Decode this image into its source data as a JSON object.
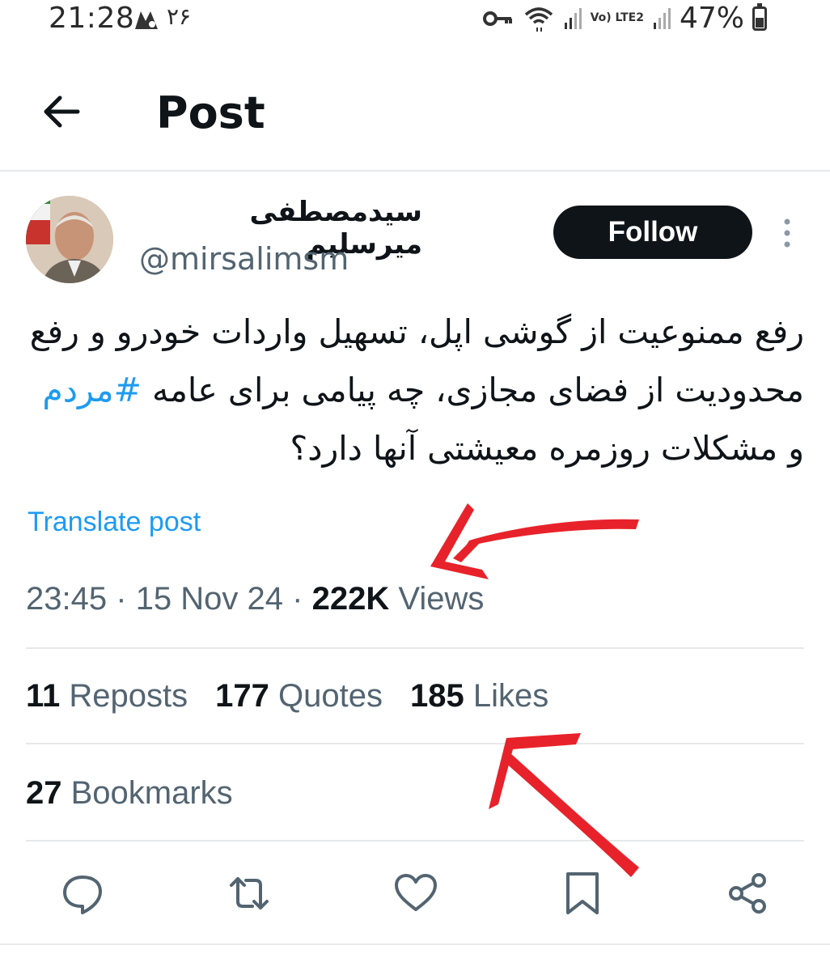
{
  "status_bar": {
    "time": "21:28",
    "notification_count": "۲۶",
    "lte_label": "Vo) LTE2",
    "battery_percent": "47%",
    "battery_level": 0.47,
    "icons": [
      "key-icon",
      "wifi-icon",
      "signal-icon",
      "signal-icon",
      "battery-icon"
    ]
  },
  "header": {
    "title": "Post",
    "back_icon": "arrow-left-icon"
  },
  "author": {
    "name": "سیدمصطفی میرسلیم",
    "handle": "@mirsalimsm",
    "follow_label": "Follow",
    "more_icon": "more-vertical-icon"
  },
  "post": {
    "text_before_hashtag": "رفع ممنوعیت از گوشی اپل، تسهیل واردات خودرو و رفع محدودیت از فضای مجازی، چه پیامی برای عامه ",
    "hashtag": "#مردم",
    "text_after_hashtag": " و مشکلات روزمره معیشتی آنها دارد؟",
    "translate_label": "Translate post"
  },
  "meta": {
    "time": "23:45",
    "separator": "·",
    "date": "15 Nov 24",
    "views_count": "222K",
    "views_label": "Views"
  },
  "stats": {
    "reposts_count": "11",
    "reposts_label": "Reposts",
    "quotes_count": "177",
    "quotes_label": "Quotes",
    "likes_count": "185",
    "likes_label": "Likes",
    "bookmarks_count": "27",
    "bookmarks_label": "Bookmarks"
  },
  "actions": [
    "reply-icon",
    "repost-icon",
    "like-icon",
    "bookmark-icon",
    "share-icon"
  ],
  "colors": {
    "accent": "#1d9bf0",
    "text_primary": "#0f1419",
    "text_secondary": "#536471",
    "divider": "#e6e8ea",
    "annotation_red": "#e8222a"
  }
}
